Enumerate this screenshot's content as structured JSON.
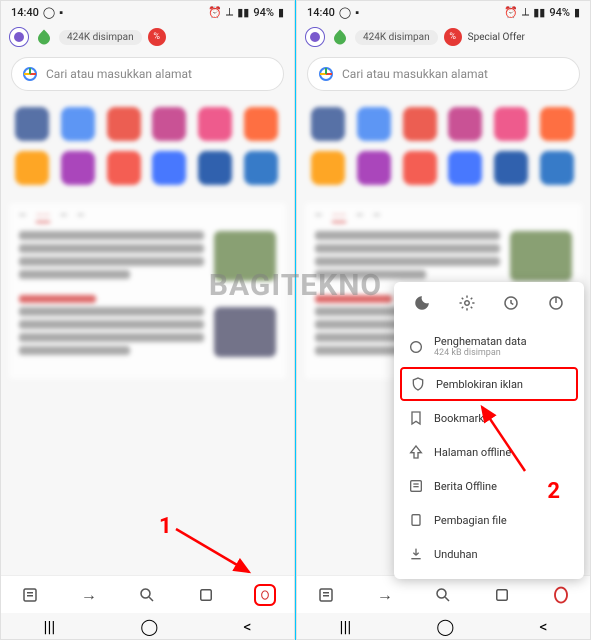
{
  "watermark": "BAGITEKNO",
  "status": {
    "time": "14:40",
    "battery": "94%"
  },
  "chips": {
    "saved": "424K disimpan",
    "special": "Special Offer"
  },
  "search": {
    "placeholder": "Cari atau masukkan alamat"
  },
  "annotation": {
    "n1": "1",
    "n2": "2"
  },
  "popup": {
    "data_saving": {
      "title": "Penghematan data",
      "sub": "424 kB disimpan"
    },
    "adblock": "Pemblokiran iklan",
    "bookmark": "Bookmark",
    "offline_page": "Halaman offline",
    "offline_news": "Berita Offline",
    "file_share": "Pembagian file",
    "download": "Unduhan"
  },
  "grid_colors": [
    "#3b5998",
    "#4285f4",
    "#ea4335",
    "#c13584",
    "#ec407a",
    "#ff5722",
    "#ff9800",
    "#9c27b0",
    "#f44336",
    "#2962ff",
    "#0d47a1",
    "#1565c0"
  ]
}
